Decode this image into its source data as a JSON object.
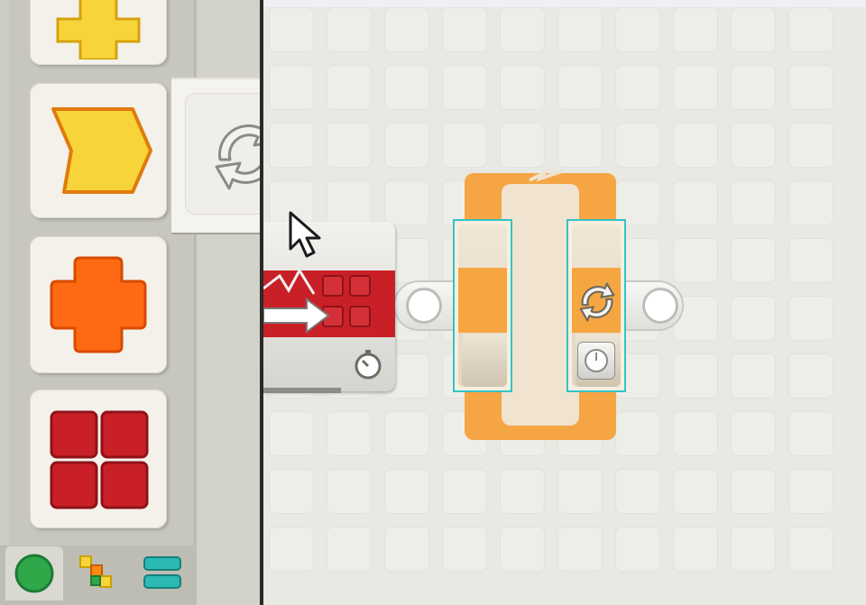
{
  "palette": {
    "blocks": [
      {
        "name": "yellow-cross-block",
        "icon": "yellow-cross-icon"
      },
      {
        "name": "yellow-flow-block",
        "icon": "yellow-arrow-flag-icon"
      },
      {
        "name": "orange-cross-block",
        "icon": "orange-cross-icon"
      },
      {
        "name": "red-grid-block",
        "icon": "red-grid-icon"
      }
    ],
    "flyout": {
      "item": "loop-block",
      "icon": "loop-arrows-icon"
    },
    "tabs": [
      {
        "name": "common-palette-tab",
        "icon": "green-circle-icon",
        "selected": true
      },
      {
        "name": "complete-palette-tab",
        "icon": "blocks-icon"
      },
      {
        "name": "custom-palette-tab",
        "icon": "teal-bars-icon"
      }
    ]
  },
  "canvas": {
    "blocks": [
      {
        "name": "move-block",
        "icons": [
          "sensor-wave-icon",
          "arrow-icon",
          "grid-icon",
          "timer-icon"
        ]
      },
      {
        "name": "loop-block",
        "icons": [
          "loop-arrows-icon",
          "power-timer-icon"
        ]
      }
    ]
  },
  "colors": {
    "yellow": "#f8d43b",
    "orange": "#fd6a13",
    "red": "#c92028",
    "loop_orange": "#f5a543",
    "selection_teal": "#35c3c4"
  }
}
